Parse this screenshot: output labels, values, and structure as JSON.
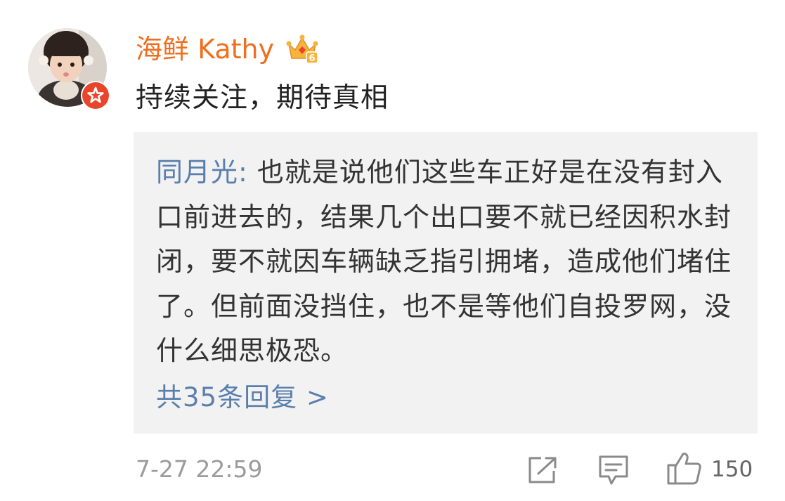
{
  "comment": {
    "username": "海鲜 Kathy",
    "text": "持续关注，期待真相",
    "timestamp": "7-27 22:59",
    "avatar_icon": "avatar-child-photo",
    "verified_icon": "verified-badge-icon",
    "vip_icon": "crown-vip-icon",
    "vip_level": "6"
  },
  "quoted_reply": {
    "author": "同月光",
    "separator": ": ",
    "text": "也就是说他们这些车正好是在没有封入口前进去的，结果几个出口要不就已经因积水封闭，要不就因车辆缺乏指引拥堵，造成他们堵住了。但前面没挡住，也不是等他们自投罗网，没什么细思极恐。",
    "replies_link": "共35条回复 >"
  },
  "actions": {
    "forward_icon": "share-forward-icon",
    "comment_icon": "comment-bubble-icon",
    "like_icon": "thumbs-up-icon",
    "like_count": "150"
  },
  "colors": {
    "username": "#f06e1e",
    "link_blue": "#5b7fad",
    "quote_background": "#f2f2f2",
    "verified_red": "#e8462b",
    "meta_gray": "#9b9b9b"
  }
}
